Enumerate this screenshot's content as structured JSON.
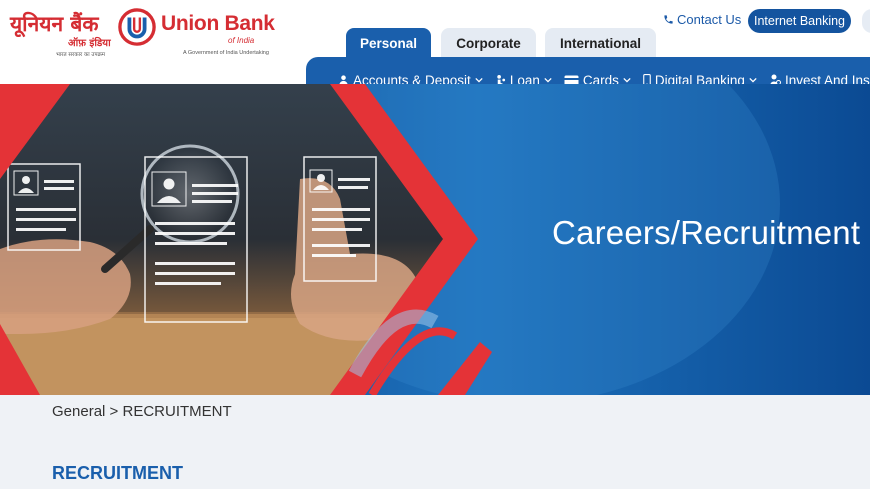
{
  "brand": {
    "hindi_name": "यूनियन बैंक",
    "hindi_subname": "ऑफ़ इंडिया",
    "hindi_tagline": "भारत सरकार का उपक्रम",
    "english_name": "Union Bank",
    "english_subname": "of India",
    "english_tagline": "A Government of India Undertaking",
    "colors": {
      "red": "#d52d33",
      "blue": "#1a5fac"
    }
  },
  "header": {
    "contact_label": "Contact Us",
    "contact_icon": "phone-icon",
    "internet_banking_label": "Internet Banking"
  },
  "tabs": [
    {
      "label": "Personal",
      "active": true
    },
    {
      "label": "Corporate",
      "active": false
    },
    {
      "label": "International",
      "active": false
    }
  ],
  "nav": [
    {
      "label": "Accounts & Deposit",
      "icon": "person-icon"
    },
    {
      "label": "Loan",
      "icon": "loan-icon"
    },
    {
      "label": "Cards",
      "icon": "card-icon"
    },
    {
      "label": "Digital Banking",
      "icon": "mobile-icon"
    },
    {
      "label": "Invest And Insure",
      "icon": "investor-icon"
    }
  ],
  "hero": {
    "title": "Careers/Recruitment",
    "image_subject": "hands holding magnifier over resume cards"
  },
  "breadcrumb": {
    "root": "General",
    "separator": ">",
    "current": "RECRUITMENT"
  },
  "page": {
    "section_title": "RECRUITMENT"
  }
}
